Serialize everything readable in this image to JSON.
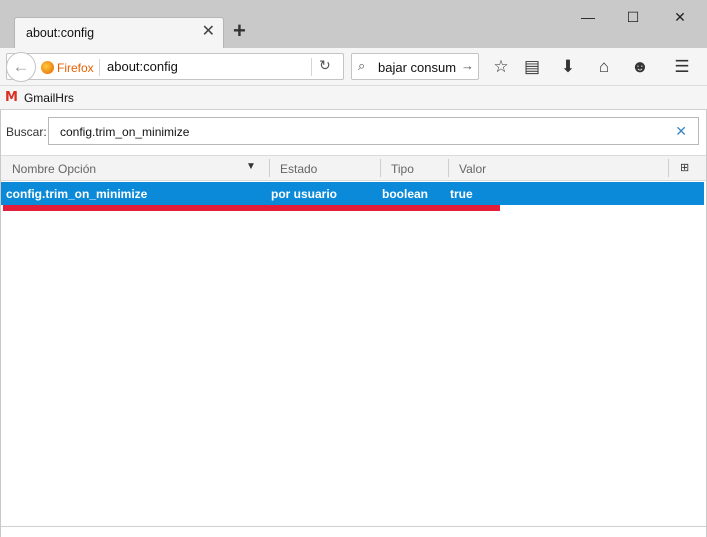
{
  "tab": {
    "title": "about:config",
    "close_glyph": "✕"
  },
  "newtab_glyph": "+",
  "window": {
    "minimize": "—",
    "maximize": "☐",
    "close": "✕"
  },
  "urlbar": {
    "back_glyph": "←",
    "identity_label": "Firefox",
    "url": "about:config",
    "reload_glyph": "↻"
  },
  "searchbar": {
    "glass": "⌕",
    "value": "bajar consum",
    "go_glyph": "→"
  },
  "toolbar_icons": {
    "bookmark": "☆",
    "reading": "▤",
    "download": "⬇",
    "home": "⌂",
    "hello": "☻",
    "menu": "☰"
  },
  "bookmarks": [
    {
      "icon": "M",
      "label": "GmailHrs"
    }
  ],
  "filter": {
    "label": "Buscar:",
    "value": "config.trim_on_minimize",
    "clear_glyph": "✕"
  },
  "columns": {
    "name": "Nombre Opción",
    "status": "Estado",
    "type": "Tipo",
    "value": "Valor",
    "sort_glyph": "▼",
    "picker_glyph": "⊞"
  },
  "rows": [
    {
      "name": "config.trim_on_minimize",
      "status": "por usuario",
      "type": "boolean",
      "value": "true"
    }
  ],
  "colors": {
    "selection": "#0b8ad9",
    "annotation_underline": "#e31d3a",
    "firefox_accent": "#e66000"
  }
}
